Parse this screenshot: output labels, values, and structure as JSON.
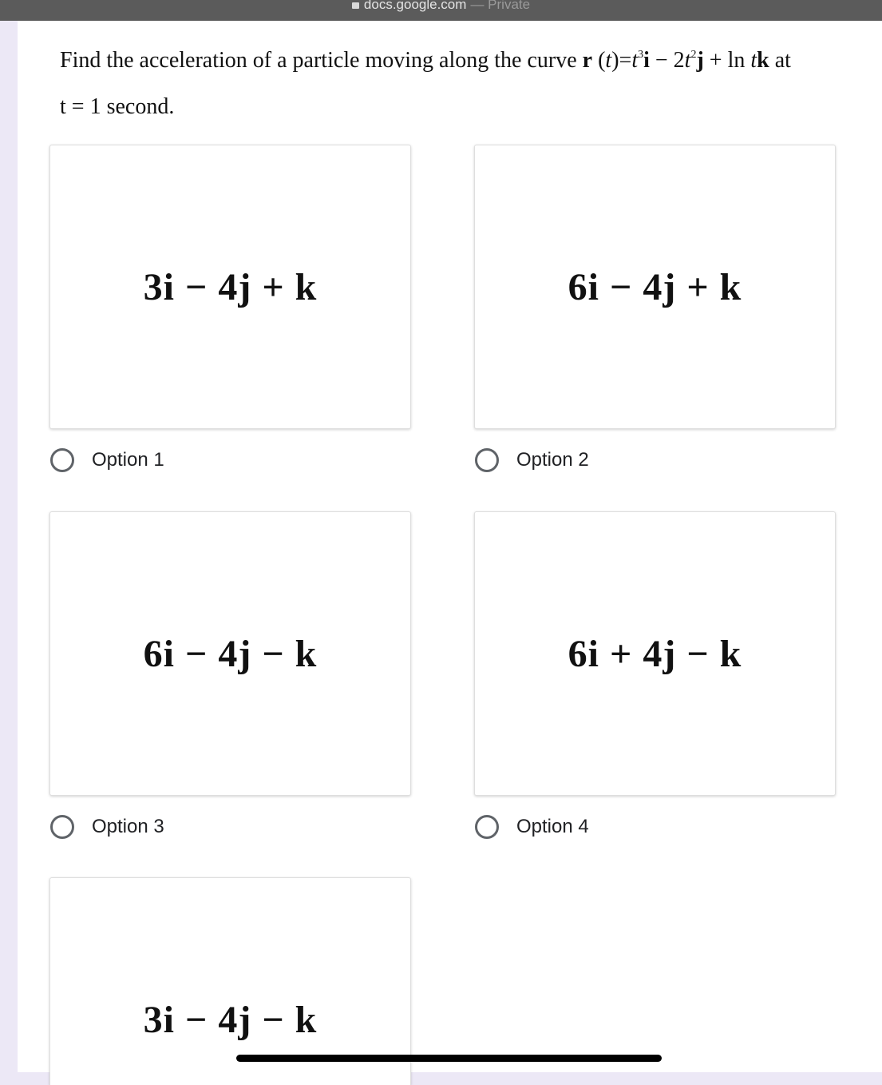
{
  "browser": {
    "domain": "docs.google.com",
    "separator": "—",
    "mode": "Private"
  },
  "question": {
    "prefix": "Find the acceleration of a particle moving along the curve",
    "r": "r",
    "open_paren": "(",
    "t": "t",
    "close_paren": ")",
    "eq": "=",
    "t3": "t",
    "exp3": "3",
    "i": "i",
    "minus": "−",
    "coef2": "2",
    "t2": "t",
    "exp2": "2",
    "j": "j",
    "plus": "+",
    "ln": "ln",
    "t_ln": "t",
    "k": "k",
    "at": "at",
    "line2": "t = 1 second."
  },
  "options": [
    {
      "expr": "3i − 4j + k",
      "label": "Option 1"
    },
    {
      "expr": "6i − 4j + k",
      "label": "Option 2"
    },
    {
      "expr": "6i − 4j − k",
      "label": "Option 3"
    },
    {
      "expr": "6i + 4j − k",
      "label": "Option 4"
    },
    {
      "expr": "3i − 4j − k",
      "label": ""
    }
  ]
}
